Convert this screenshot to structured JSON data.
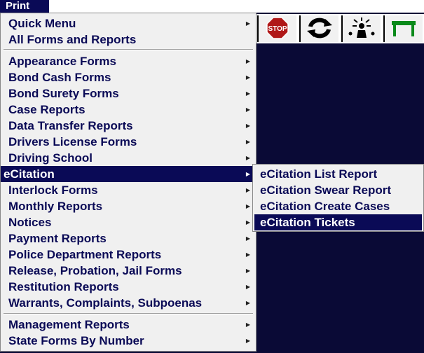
{
  "menubar": {
    "print_label": "Print"
  },
  "toolbar": {
    "buttons": [
      {
        "name": "stop",
        "label": "STOP",
        "color": "#b01818"
      },
      {
        "name": "refresh",
        "color": "#000000"
      },
      {
        "name": "people",
        "color": "#000000"
      },
      {
        "name": "table",
        "color": "#0a8a1a"
      }
    ]
  },
  "menu": {
    "items": [
      {
        "label": "Quick Menu",
        "has_submenu": true
      },
      {
        "label": "All Forms and Reports",
        "has_submenu": false
      },
      {
        "label": "Appearance Forms",
        "has_submenu": true
      },
      {
        "label": "Bond Cash Forms",
        "has_submenu": true
      },
      {
        "label": "Bond Surety Forms",
        "has_submenu": true
      },
      {
        "label": "Case Reports",
        "has_submenu": true
      },
      {
        "label": "Data Transfer Reports",
        "has_submenu": true
      },
      {
        "label": "Drivers License Forms",
        "has_submenu": true
      },
      {
        "label": "Driving School",
        "has_submenu": true
      },
      {
        "label": "eCitation",
        "has_submenu": true,
        "selected": true
      },
      {
        "label": "Interlock Forms",
        "has_submenu": true
      },
      {
        "label": "Monthly Reports",
        "has_submenu": true
      },
      {
        "label": "Notices",
        "has_submenu": true
      },
      {
        "label": "Payment Reports",
        "has_submenu": true
      },
      {
        "label": "Police Department Reports",
        "has_submenu": true
      },
      {
        "label": "Release, Probation, Jail Forms",
        "has_submenu": true
      },
      {
        "label": "Restitution Reports",
        "has_submenu": true
      },
      {
        "label": "Warrants, Complaints, Subpoenas",
        "has_submenu": true
      },
      {
        "label": "Management Reports",
        "has_submenu": true
      },
      {
        "label": "State Forms By Number",
        "has_submenu": true
      }
    ]
  },
  "submenu": {
    "items": [
      {
        "label": "eCitation List Report"
      },
      {
        "label": "eCitation Swear Report"
      },
      {
        "label": "eCitation Create Cases"
      },
      {
        "label": "eCitation Tickets",
        "selected": true
      }
    ]
  },
  "colors": {
    "navy": "#0a0a56",
    "background": "#0a0a36",
    "menu_bg": "#f0f0f0"
  }
}
